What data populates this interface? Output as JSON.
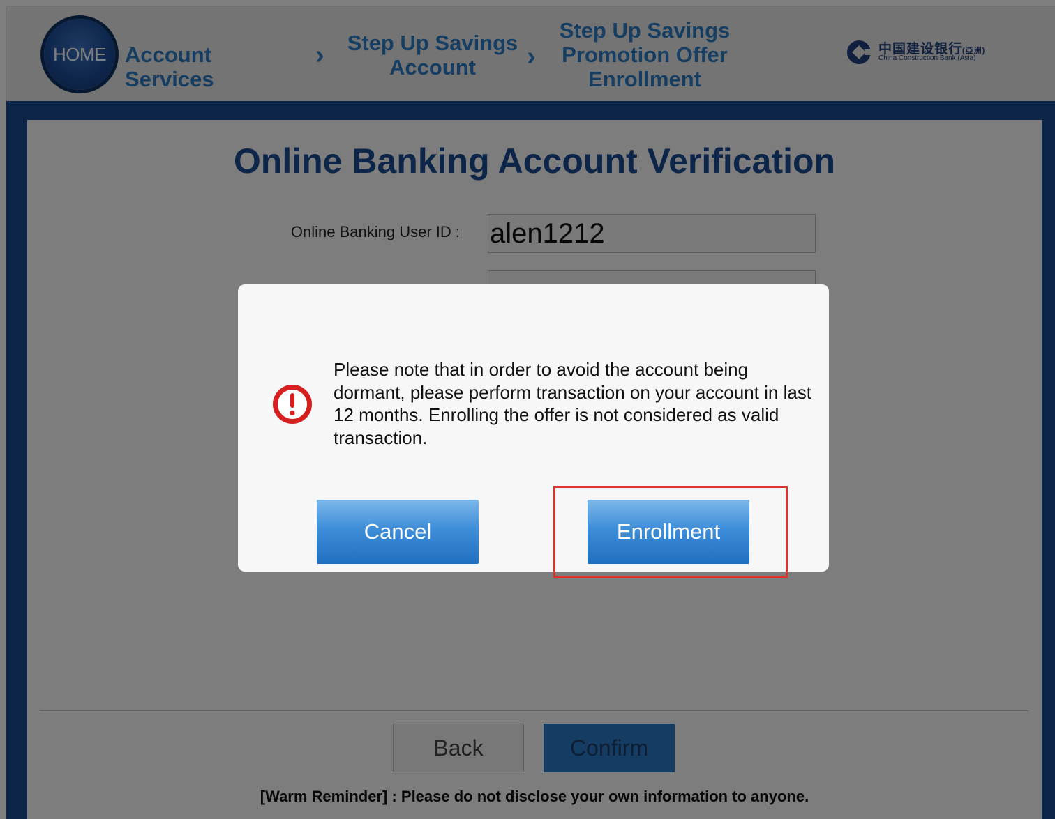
{
  "header": {
    "home_label": "HOME",
    "breadcrumbs": [
      {
        "label": "Account Services"
      },
      {
        "label": "Step Up Savings Account"
      },
      {
        "label": "Step Up Savings Promotion Offer Enrollment"
      }
    ],
    "separator": "›",
    "logo": {
      "chinese_name": "中国建设银行",
      "chinese_suffix": "(亞洲)",
      "english_name": "China Construction Bank (Asia)"
    }
  },
  "page": {
    "title": "Online Banking Account Verification",
    "user_id_label": "Online Banking User ID :",
    "user_id_value": "alen1212",
    "back_label": "Back",
    "confirm_label": "Confirm",
    "reminder": "[Warm Reminder] : Please do not disclose your own information to anyone."
  },
  "modal": {
    "message": "Please note that in order to avoid the account being dormant, please perform transaction on your account in last 12 months. Enrolling the offer is not considered as valid transaction.",
    "cancel_label": "Cancel",
    "enrollment_label": "Enrollment"
  },
  "colors": {
    "brand_blue": "#1b4b90",
    "link_blue": "#2c7cc4",
    "alert_red": "#d62020",
    "highlight_red": "#e0312e"
  },
  "icons": {
    "alert": "exclamation-circle-icon",
    "logo": "ccb-logo-icon"
  }
}
